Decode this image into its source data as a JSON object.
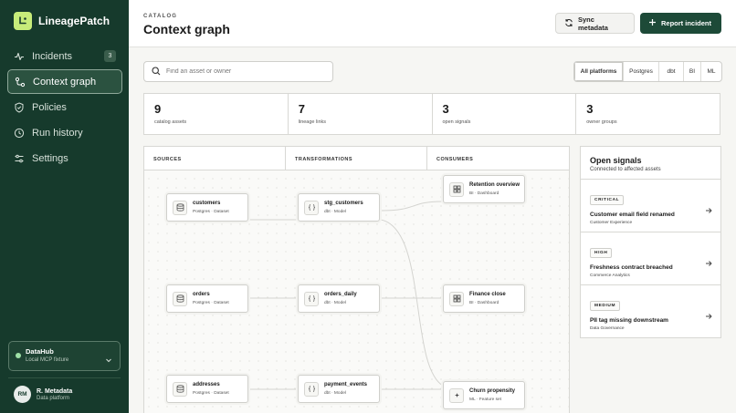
{
  "brand": {
    "name": "LineagePatch"
  },
  "sidebar": {
    "items": [
      {
        "label": "Incidents",
        "icon": "pulse-icon",
        "badge": "3"
      },
      {
        "label": "Context graph",
        "icon": "graph-icon",
        "active": true
      },
      {
        "label": "Policies",
        "icon": "shield-icon"
      },
      {
        "label": "Run history",
        "icon": "history-icon"
      },
      {
        "label": "Settings",
        "icon": "sliders-icon"
      }
    ],
    "workspace": {
      "name": "DataHub",
      "subtitle": "Local MCP fixture"
    },
    "user": {
      "initials": "RM",
      "name": "R. Metadata",
      "role": "Data platform"
    }
  },
  "header": {
    "eyebrow": "CATALOG",
    "title": "Context graph",
    "sync_label": "Sync metadata",
    "report_label": "Report incident"
  },
  "search": {
    "placeholder": "Find an asset or owner",
    "value": ""
  },
  "filters": [
    "All platforms",
    "Postgres",
    "dbt",
    "BI",
    "ML"
  ],
  "filters_active": "All platforms",
  "stats": [
    {
      "value": "9",
      "label": "catalog assets"
    },
    {
      "value": "7",
      "label": "lineage links"
    },
    {
      "value": "3",
      "label": "open signals"
    },
    {
      "value": "3",
      "label": "owner groups"
    }
  ],
  "graph": {
    "columns": [
      "SOURCES",
      "TRANSFORMATIONS",
      "CONSUMERS"
    ],
    "nodes": [
      {
        "name": "customers",
        "meta": "Postgres · Dataset",
        "icon": "database-icon"
      },
      {
        "name": "orders",
        "meta": "Postgres · Dataset",
        "icon": "database-icon"
      },
      {
        "name": "addresses",
        "meta": "Postgres · Dataset",
        "icon": "database-icon"
      },
      {
        "name": "stg_customers",
        "meta": "dbt · Model",
        "icon": "code-icon"
      },
      {
        "name": "orders_daily",
        "meta": "dbt · Model",
        "icon": "code-icon"
      },
      {
        "name": "payment_events",
        "meta": "dbt · Model",
        "icon": "code-icon"
      },
      {
        "name": "Retention overview",
        "meta": "BI · Dashboard",
        "icon": "dashboard-icon"
      },
      {
        "name": "Finance close",
        "meta": "BI · Dashboard",
        "icon": "dashboard-icon"
      },
      {
        "name": "Churn propensity",
        "meta": "ML · Feature set",
        "icon": "sparkle-icon"
      }
    ]
  },
  "signals": {
    "title": "Open signals",
    "subtitle": "Connected to affected assets",
    "items": [
      {
        "severity": "CRITICAL",
        "title": "Customer email field renamed",
        "team": "Customer Experience"
      },
      {
        "severity": "HIGH",
        "title": "Freshness contract breached",
        "team": "Commerce Analytics"
      },
      {
        "severity": "MEDIUM",
        "title": "PII tag missing downstream",
        "team": "Data Governance"
      }
    ]
  },
  "colors": {
    "sidebar": "#163a2c",
    "accent": "#1d4a38",
    "brand_logo": "#c7ec7a"
  }
}
